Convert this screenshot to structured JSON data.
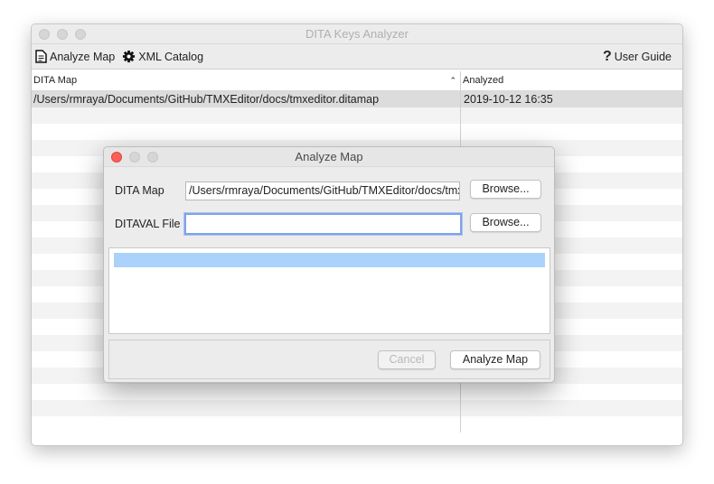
{
  "window": {
    "title": "DITA Keys Analyzer"
  },
  "toolbar": {
    "analyze_map": "Analyze Map",
    "xml_catalog": "XML Catalog",
    "user_guide": "User Guide"
  },
  "table": {
    "columns": [
      "DITA Map",
      "Analyzed"
    ],
    "rows": [
      {
        "map": "/Users/rmraya/Documents/GitHub/TMXEditor/docs/tmxeditor.ditamap",
        "analyzed": "2019-10-12 16:35"
      }
    ]
  },
  "dialog": {
    "title": "Analyze Map",
    "dita_map_label": "DITA Map",
    "dita_map_value": "/Users/rmraya/Documents/GitHub/TMXEditor/docs/tmxeditor.ditamap",
    "ditaval_label": "DITAVAL File",
    "ditaval_value": "",
    "browse": "Browse...",
    "cancel": "Cancel",
    "analyze": "Analyze Map"
  },
  "colors": {
    "selection": "#abd2fb",
    "focus": "#7fa3ea",
    "close": "#fc5f57"
  }
}
